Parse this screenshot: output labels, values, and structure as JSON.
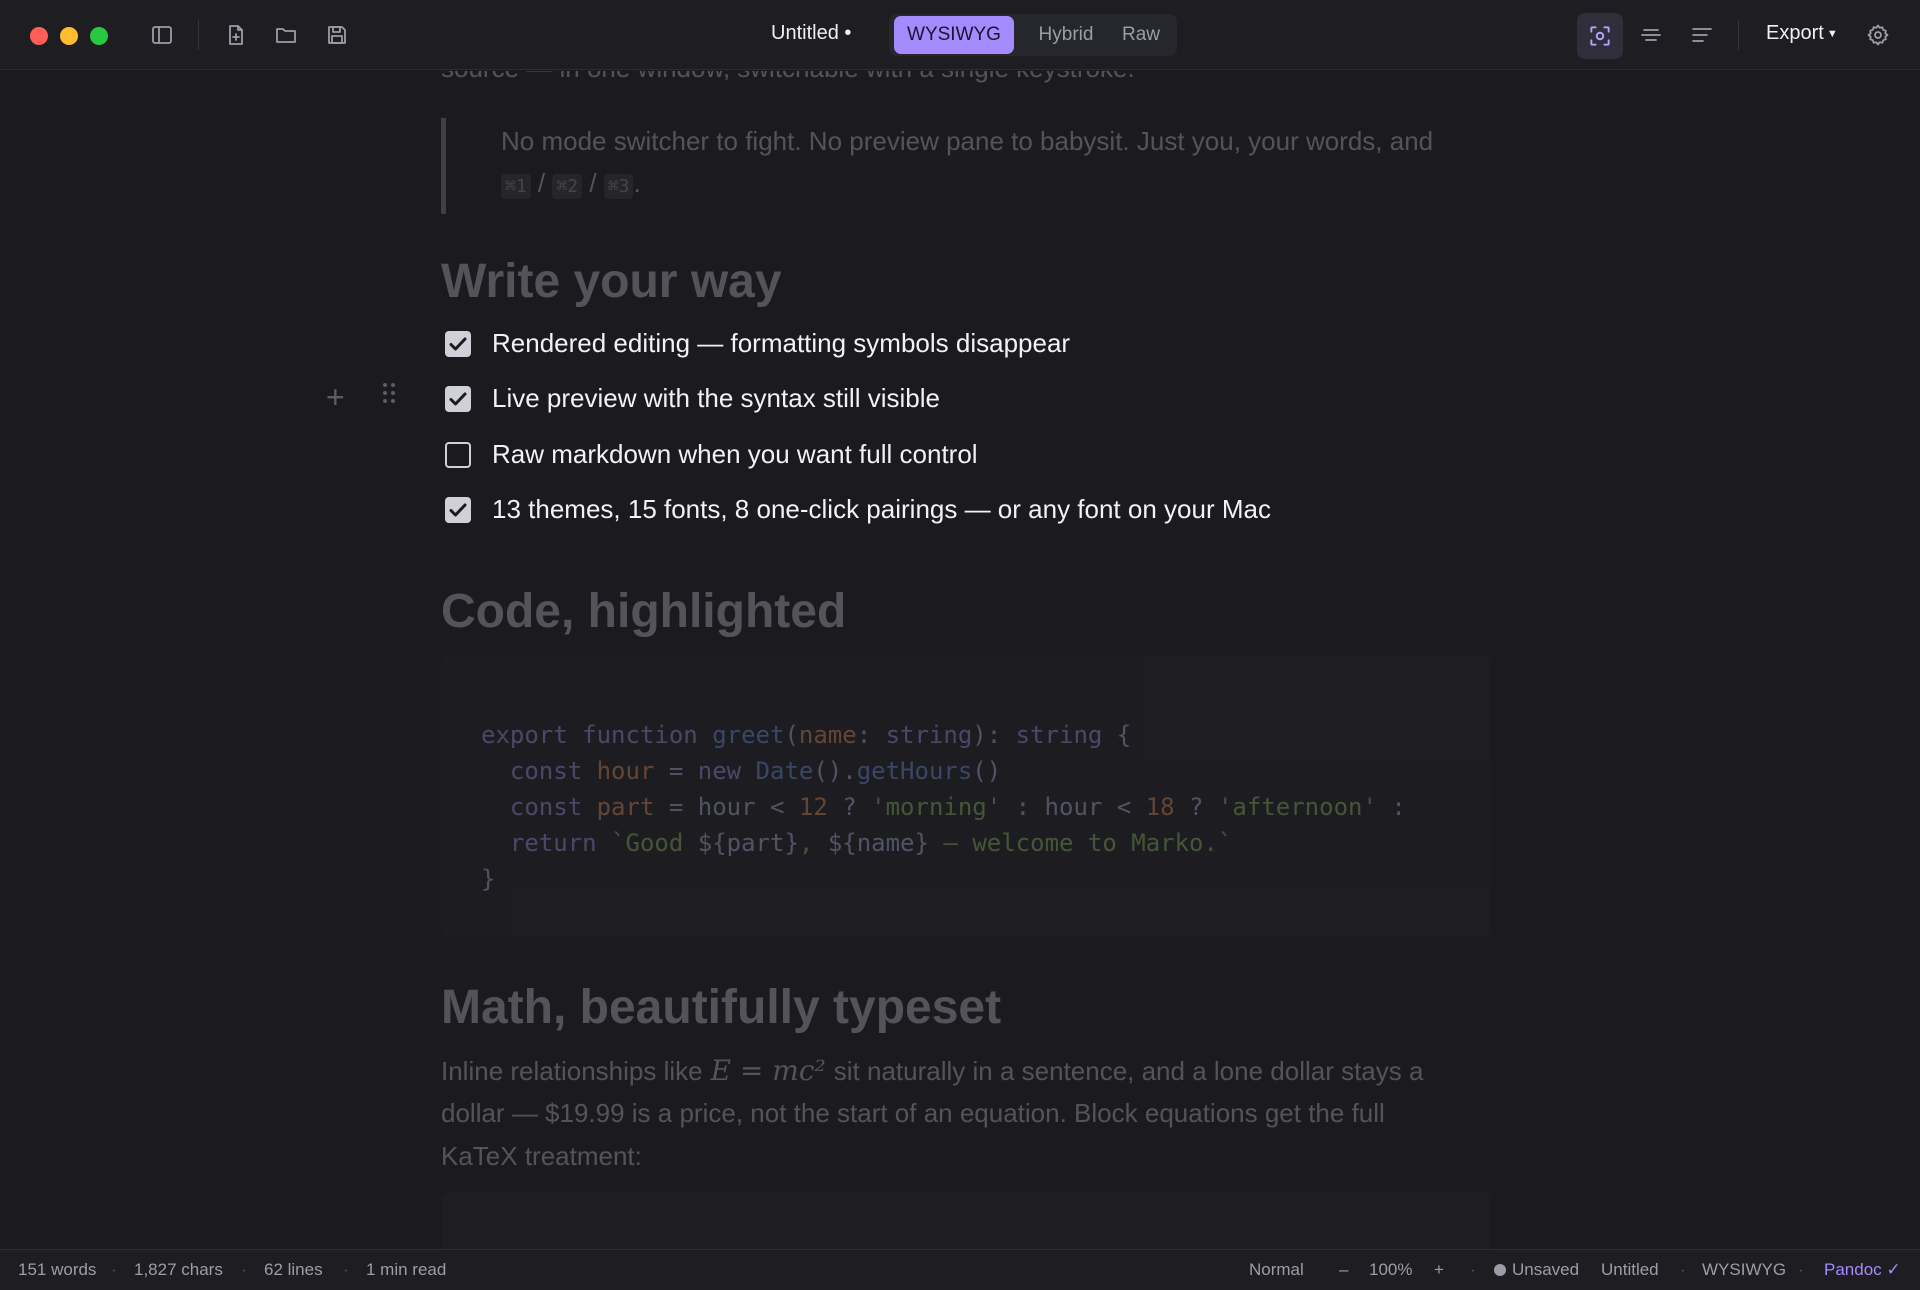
{
  "window": {
    "doc_title": "Untitled •",
    "modes": [
      "WYSIWYG",
      "Hybrid",
      "Raw"
    ],
    "active_mode": "WYSIWYG",
    "export_label": "Export",
    "accent": "#a48afc"
  },
  "document": {
    "intro_tail": "source — in one window, switchable with a single keystroke.",
    "quote": {
      "line1": "No mode switcher to fight. No preview pane to babysit. Just you, your words, and",
      "keys": [
        "⌘1",
        "⌘2",
        "⌘3"
      ],
      "sep": "/",
      "end": "."
    },
    "section1_heading": "Write your way",
    "tasks": [
      {
        "label": "Rendered editing — formatting symbols disappear",
        "checked": true
      },
      {
        "label": "Live preview with the syntax still visible",
        "checked": true
      },
      {
        "label": "Raw markdown when you want full control",
        "checked": false
      },
      {
        "label": "13 themes, 15 fonts, 8 one-click pairings — or any font on your Mac",
        "checked": true
      }
    ],
    "section2_heading": "Code, highlighted",
    "code_lines": [
      "export function greet(name: string): string {",
      "  const hour = new Date().getHours()",
      "  const part = hour < 12 ? 'morning' : hour < 18 ? 'afternoon' :",
      "  return `Good ${part}, ${name} — welcome to Marko.`",
      "}"
    ],
    "section3_heading": "Math, beautifully typeset",
    "math_para": {
      "pre": "Inline relationships like",
      "formula": "E = mc²",
      "post": "sit naturally in a sentence, and a lone dollar stays a",
      "line2": "dollar — $19.99 is a price, not the start of an equation. Block equations get the full",
      "line3": "KaTeX treatment:"
    }
  },
  "status": {
    "words": "151 words",
    "chars": "1,827 chars",
    "lines": "62 lines",
    "read": "1 min read",
    "style": "Normal",
    "zoom_minus": "–",
    "zoom": "100%",
    "zoom_plus": "+",
    "save_state": "Unsaved",
    "file": "Untitled",
    "mode": "WYSIWYG",
    "exporter": "Pandoc ✓"
  }
}
